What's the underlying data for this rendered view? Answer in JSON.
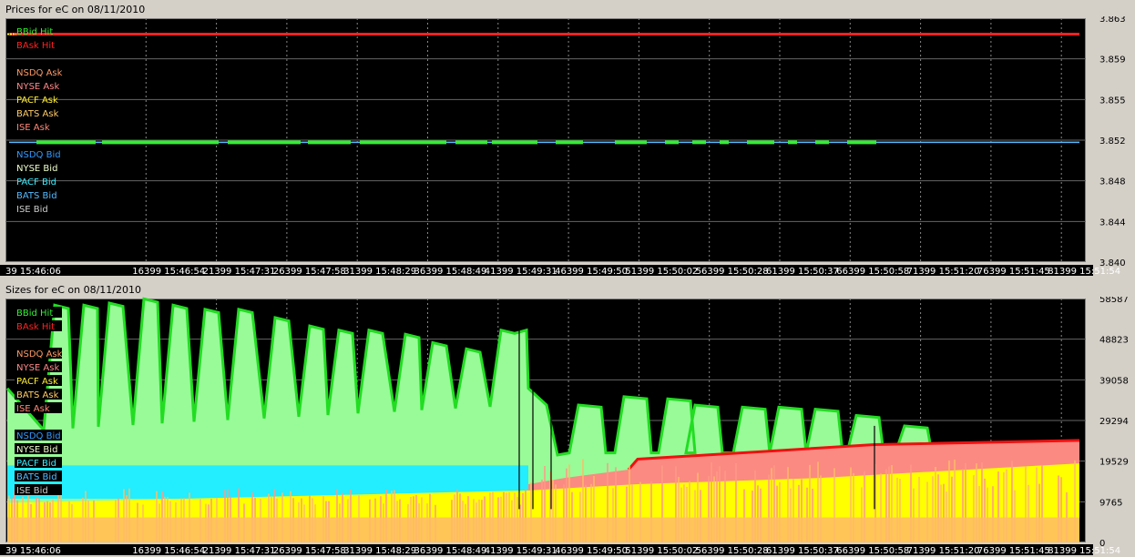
{
  "top_title": "Prices for  eC  on  08/11/2010",
  "bottom_title": "Sizes for  eC  on  08/11/2010",
  "x_ticks": [
    "39 15:46:06",
    "16399 15:46:54",
    "21399 15:47:31",
    "26399 15:47:58",
    "31399 15:48:29",
    "36399 15:48:49",
    "41399 15:49:31",
    "46399 15:49:50",
    "51399 15:50:02",
    "56399 15:50:28",
    "61399 15:50:37",
    "66399 15:50:58",
    "71399 15:51:20",
    "76399 15:51:45",
    "81399 15:51:54"
  ],
  "legend": [
    {
      "label": "BBid Hit",
      "color": "#33ee33"
    },
    {
      "label": "BAsk Hit",
      "color": "#ff2222"
    },
    {
      "label": "NSDQ Ask",
      "color": "#ff9966"
    },
    {
      "label": "NYSE Ask",
      "color": "#ff8888"
    },
    {
      "label": "PACF Ask",
      "color": "#ffee33"
    },
    {
      "label": "BATS Ask",
      "color": "#ffcc66"
    },
    {
      "label": "ISE Ask",
      "color": "#ff8877"
    },
    {
      "label": "NSDQ Bid",
      "color": "#3399ff"
    },
    {
      "label": "NYSE Bid",
      "color": "#eeffcc"
    },
    {
      "label": "PACF Bid",
      "color": "#33eeff"
    },
    {
      "label": "BATS Bid",
      "color": "#55bbff"
    },
    {
      "label": "ISE Bid",
      "color": "#cccccc"
    }
  ],
  "chart_data": [
    {
      "type": "line",
      "title": "Prices for  eC  on  08/11/2010",
      "y_ticks": [
        "3.863",
        "3.859",
        "3.855",
        "3.852",
        "3.848",
        "3.844",
        "3.840"
      ],
      "ylim": [
        3.84,
        3.863
      ],
      "grid": true,
      "series": [
        {
          "name": "BAsk Hit",
          "color": "#ff2222",
          "y": 3.8615
        },
        {
          "name": "NSDQ Bid",
          "color": "#55bbff",
          "y": 3.8513
        },
        {
          "name": "BBid Hit",
          "color": "#33ee33",
          "y": 3.8513
        }
      ]
    },
    {
      "type": "area",
      "title": "Sizes for  eC  on  08/11/2010",
      "y_ticks": [
        "58587",
        "48823",
        "39058",
        "29294",
        "19529",
        "9765",
        "0"
      ],
      "ylim": [
        0,
        58587
      ],
      "grid": true,
      "bbid_hit_peaks": [
        57000,
        57500,
        58500,
        57500,
        56000,
        54000,
        52500,
        51000,
        50500,
        50000,
        48000,
        46500,
        51000,
        35000,
        35500,
        34000,
        33000,
        33000,
        32000,
        30500
      ],
      "bask_hit_level": [
        20000,
        24500
      ]
    }
  ]
}
